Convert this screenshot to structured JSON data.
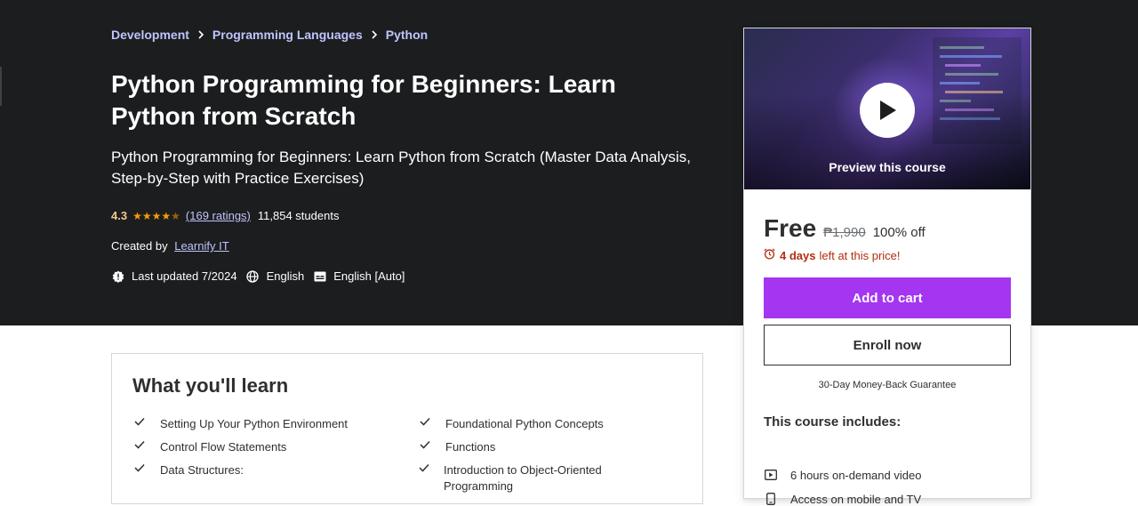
{
  "breadcrumb": [
    "Development",
    "Programming Languages",
    "Python"
  ],
  "course": {
    "title": "Python Programming for Beginners: Learn Python from Scratch",
    "subtitle": "Python Programming for Beginners: Learn Python from Scratch (Master Data Analysis, Step-by-Step with Practice Exercises)",
    "rating": "4.3",
    "stars_value": 4.3,
    "ratings_text": "(169 ratings)",
    "students": "11,854 students",
    "created_by_label": "Created by",
    "author": "Learnify IT",
    "last_updated": "Last updated 7/2024",
    "language": "English",
    "captions": "English [Auto]"
  },
  "sidebar": {
    "preview_label": "Preview this course",
    "price": "Free",
    "original_price": "₱1,990",
    "discount": "100% off",
    "timer_days": "4 days",
    "timer_rest": "left at this price!",
    "add_to_cart": "Add to cart",
    "enroll_now": "Enroll now",
    "guarantee": "30-Day Money-Back Guarantee",
    "includes_title": "This course includes:",
    "includes": [
      {
        "icon": "video-icon",
        "label": "6 hours on-demand video"
      },
      {
        "icon": "mobile-icon",
        "label": "Access on mobile and TV"
      }
    ]
  },
  "learn": {
    "title": "What you'll learn",
    "items": [
      "Setting Up Your Python Environment",
      "Foundational Python Concepts",
      "Control Flow Statements",
      "Functions",
      "Data Structures:",
      "Introduction to Object-Oriented Programming"
    ]
  },
  "colors": {
    "hero_bg": "#1c1d1f",
    "link": "#c0c4fc",
    "star": "#f69c08",
    "cta": "#a435f0",
    "timer": "#b32d0f"
  }
}
